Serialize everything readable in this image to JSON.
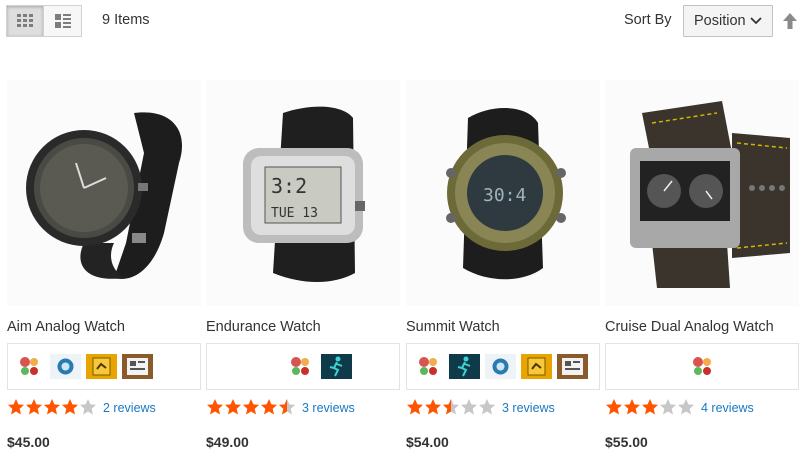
{
  "toolbar": {
    "amount_text": "9 Items",
    "sort_label": "Sort By",
    "sort_selected": "Position",
    "grid_mode_icon": "grid-icon",
    "list_mode_icon": "list-icon",
    "sort_direction_icon": "arrow-up-icon"
  },
  "colors": {
    "star_filled": "#ff5501",
    "star_empty": "#c7c7c7",
    "link": "#1979c3"
  },
  "products": [
    {
      "name": "Aim Analog Watch",
      "rating_stars": 4,
      "reviews": "2 reviews",
      "price": "$45.00",
      "swatches": [
        "activity-multi-icon",
        "clock-gauge-icon",
        "yellow-watch-icon",
        "newspaper-icon"
      ]
    },
    {
      "name": "Endurance Watch",
      "rating_stars": 4.5,
      "reviews": "3 reviews",
      "price": "$49.00",
      "swatches": [
        "activity-multi-icon",
        "runner-icon"
      ]
    },
    {
      "name": "Summit Watch",
      "rating_stars": 2.5,
      "reviews": "3 reviews",
      "price": "$54.00",
      "swatches": [
        "activity-multi-icon",
        "runner-icon",
        "clock-gauge-icon",
        "yellow-watch-icon",
        "newspaper-icon"
      ]
    },
    {
      "name": "Cruise Dual Analog Watch",
      "rating_stars": 3,
      "reviews": "4 reviews",
      "price": "$55.00",
      "swatches": [
        "activity-multi-icon"
      ]
    }
  ]
}
